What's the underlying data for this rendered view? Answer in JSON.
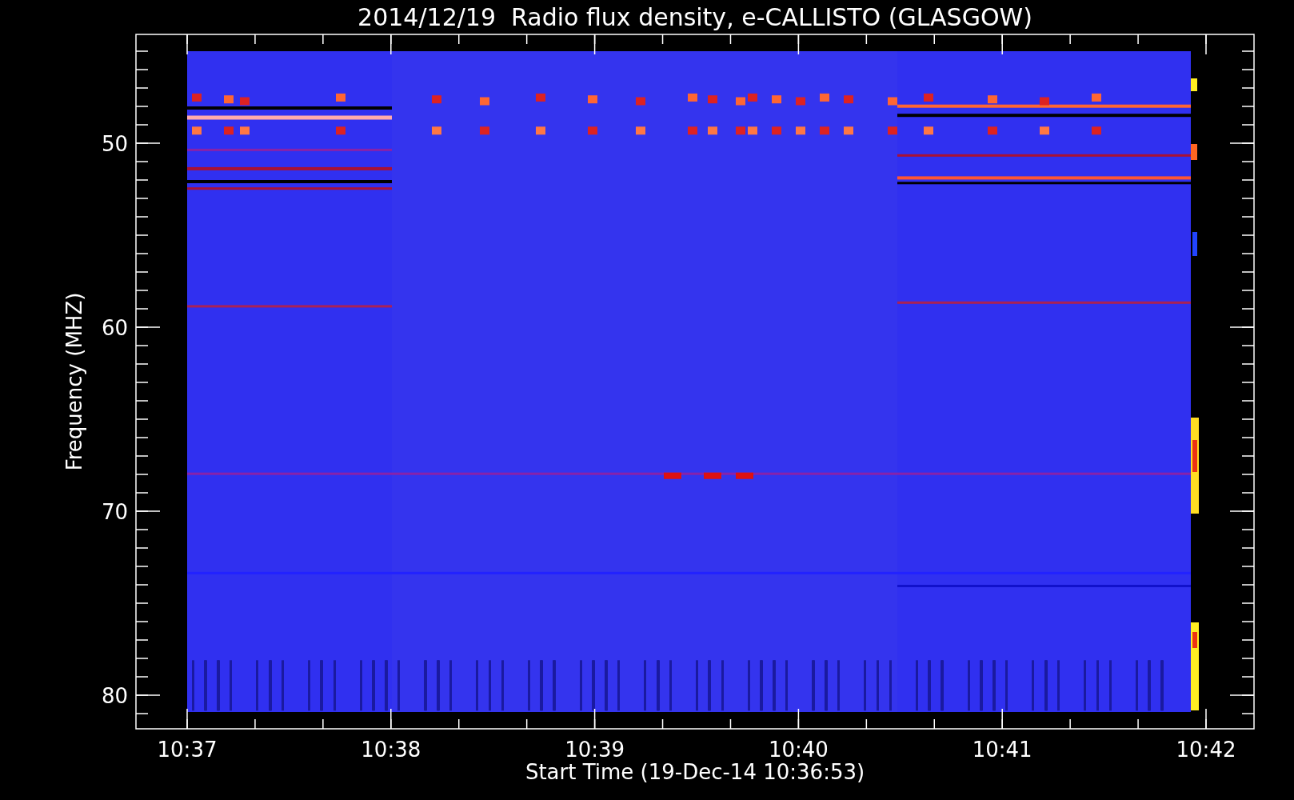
{
  "title": "2014/12/19  Radio flux density, e-CALLISTO (GLASGOW)",
  "plot": {
    "ylabel": "Frequency (MHZ)",
    "xlabel": "Start Time (19-Dec-14 10:36:53)",
    "yticks": [
      "50",
      "60",
      "70",
      "80"
    ],
    "xticks": [
      "10:37",
      "10:38",
      "10:39",
      "10:40",
      "10:41",
      "10:42"
    ]
  }
}
